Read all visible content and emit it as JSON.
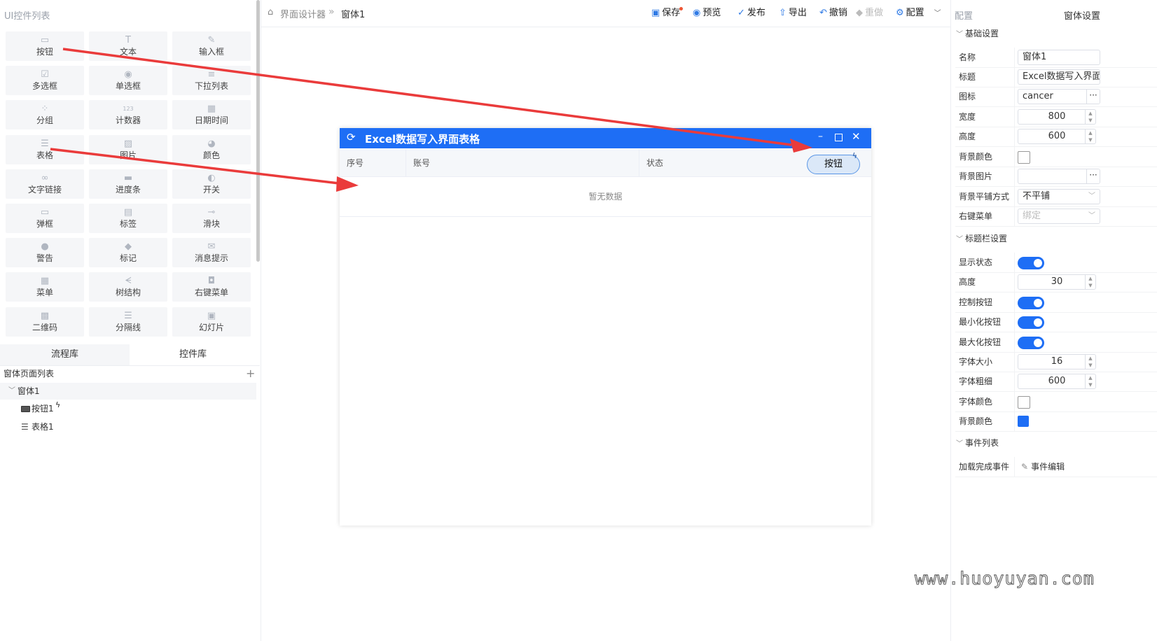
{
  "left_panel": {
    "title": "UI控件列表",
    "controls": [
      {
        "label": "按钮",
        "icon": "button-icon"
      },
      {
        "label": "文本",
        "icon": "text-icon"
      },
      {
        "label": "输入框",
        "icon": "pencil-icon"
      },
      {
        "label": "多选框",
        "icon": "checkbox-icon"
      },
      {
        "label": "单选框",
        "icon": "radio-icon"
      },
      {
        "label": "下拉列表",
        "icon": "dropdown-icon"
      },
      {
        "label": "分组",
        "icon": "group-icon"
      },
      {
        "label": "计数器",
        "icon": "counter-icon"
      },
      {
        "label": "日期时间",
        "icon": "calendar-icon"
      },
      {
        "label": "表格",
        "icon": "table-icon"
      },
      {
        "label": "图片",
        "icon": "image-icon"
      },
      {
        "label": "颜色",
        "icon": "palette-icon"
      },
      {
        "label": "文字链接",
        "icon": "link-icon"
      },
      {
        "label": "进度条",
        "icon": "progress-icon"
      },
      {
        "label": "开关",
        "icon": "switch-icon"
      },
      {
        "label": "弹框",
        "icon": "dialog-icon"
      },
      {
        "label": "标签",
        "icon": "label-icon"
      },
      {
        "label": "滑块",
        "icon": "slider-icon"
      },
      {
        "label": "警告",
        "icon": "warning-icon"
      },
      {
        "label": "标记",
        "icon": "tag-icon"
      },
      {
        "label": "消息提示",
        "icon": "message-icon"
      },
      {
        "label": "菜单",
        "icon": "menu-icon"
      },
      {
        "label": "树结构",
        "icon": "tree-icon"
      },
      {
        "label": "右键菜单",
        "icon": "mouse-icon"
      },
      {
        "label": "二维码",
        "icon": "qrcode-icon"
      },
      {
        "label": "分隔线",
        "icon": "divider-icon"
      },
      {
        "label": "幻灯片",
        "icon": "slideshow-icon"
      }
    ],
    "tabs": [
      "流程库",
      "控件库"
    ],
    "page_list_title": "窗体页面列表",
    "add_symbol": "+",
    "tree": {
      "root": "窗体1",
      "children": [
        "按钮1",
        "表格1"
      ]
    }
  },
  "toolbar": {
    "breadcrumb_home": "界面设计器",
    "breadcrumb_sep": "»",
    "breadcrumb_current": "窗体1",
    "save": "保存",
    "preview": "预览",
    "publish": "发布",
    "export": "导出",
    "undo": "撤销",
    "redo": "重做",
    "config": "配置"
  },
  "window": {
    "title": "Excel数据写入界面表格",
    "columns": [
      "序号",
      "账号",
      "状态"
    ],
    "button_label": "按钮",
    "empty_text": "暂无数据",
    "accent": "#1e6ef5"
  },
  "right_panel": {
    "title": "配置",
    "subtitle": "窗体设置",
    "basic_section": "基础设置",
    "basic": {
      "name_label": "名称",
      "name_value": "窗体1",
      "title_label": "标题",
      "title_value": "Excel数据写入界面",
      "icon_label": "图标",
      "icon_value": "cancer",
      "width_label": "宽度",
      "width_value": "800",
      "height_label": "高度",
      "height_value": "600",
      "bgcolor_label": "背景颜色",
      "bgimage_label": "背景图片",
      "tile_label": "背景平铺方式",
      "tile_value": "不平铺",
      "context_label": "右键菜单",
      "context_value": "绑定"
    },
    "titlebar_section": "标题栏设置",
    "titlebar": {
      "show_label": "显示状态",
      "height_label": "高度",
      "height_value": "30",
      "control_label": "控制按钮",
      "min_label": "最小化按钮",
      "max_label": "最大化按钮",
      "fontsize_label": "字体大小",
      "fontsize_value": "16",
      "fontweight_label": "字体粗细",
      "fontweight_value": "600",
      "fontcolor_label": "字体颜色",
      "bgcolor_label": "背景颜色",
      "bgcolor_value": "#1e6ef5"
    },
    "events_section": "事件列表",
    "events": {
      "load_label": "加载完成事件",
      "edit_label": "事件编辑"
    },
    "dots": "···"
  },
  "watermark": "www.huoyuyan.com"
}
